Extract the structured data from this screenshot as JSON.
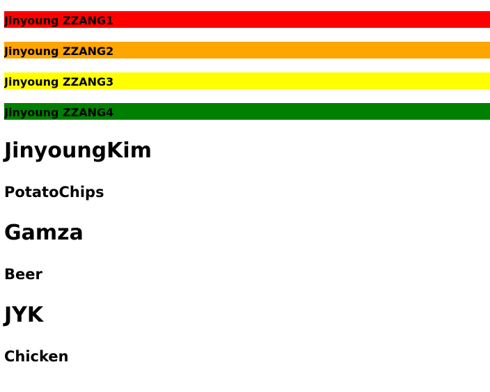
{
  "bars": [
    {
      "label": "Jinyoung ZZANG1",
      "color": "#ff0000"
    },
    {
      "label": "Jinyoung ZZANG2",
      "color": "#ffa500"
    },
    {
      "label": "Jinyoung ZZANG3",
      "color": "#ffff00"
    },
    {
      "label": "Jinyoung ZZANG4",
      "color": "#008000"
    }
  ],
  "headings": [
    {
      "text": "JinyoungKim",
      "level": "h1"
    },
    {
      "text": "PotatoChips",
      "level": "h3"
    },
    {
      "text": "Gamza",
      "level": "h1"
    },
    {
      "text": "Beer",
      "level": "h3"
    },
    {
      "text": "JYK",
      "level": "h1"
    },
    {
      "text": "Chicken",
      "level": "h3"
    }
  ]
}
